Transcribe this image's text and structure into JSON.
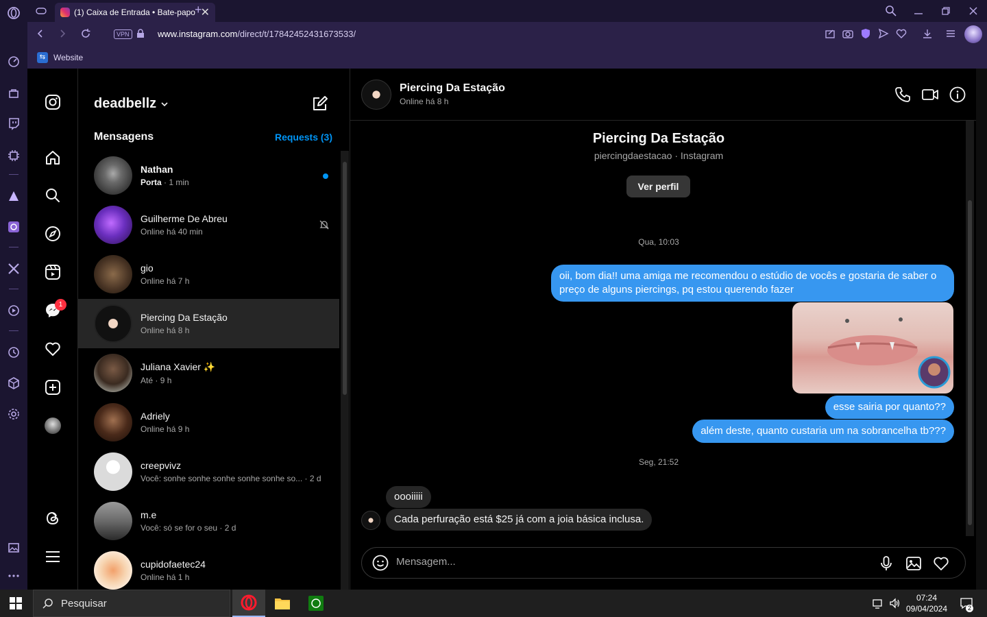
{
  "browser": {
    "tab_title": "(1) Caixa de Entrada • Bate-papo",
    "url_host": "www.instagram.com",
    "url_path": "/direct/t/17842452431673533/",
    "vpn_label": "VPN",
    "bookmark_label": "Website"
  },
  "nav": {
    "notification_count": "1"
  },
  "list": {
    "username": "deadbellz",
    "messages_heading": "Mensagens",
    "requests_label": "Requests (3)",
    "conversations": [
      {
        "name": "Nathan",
        "preview": "Porta",
        "time": "· 1 min",
        "unread": true
      },
      {
        "name": "Guilherme De Abreu",
        "preview": "Online há 40 min",
        "time": "",
        "muted": true
      },
      {
        "name": "gio",
        "preview": "Online há 7 h",
        "time": ""
      },
      {
        "name": "Piercing Da Estação",
        "preview": "Online há 8 h",
        "time": "",
        "selected": true
      },
      {
        "name": "Juliana Xavier ✨",
        "preview": "Até",
        "time": "· 9 h"
      },
      {
        "name": "Adriely",
        "preview": "Online há 9 h",
        "time": ""
      },
      {
        "name": "creepvivz",
        "preview": "Você: sonhe sonhe sonhe sonhe sonhe so...",
        "time": "· 2 d"
      },
      {
        "name": "m.e",
        "preview": "Você: só se for o seu",
        "time": "· 2 d"
      },
      {
        "name": "cupidofaetec24",
        "preview": "Online há 1 h",
        "time": ""
      }
    ]
  },
  "chat": {
    "name": "Piercing Da Estação",
    "status": "Online há 8 h",
    "profile_handle": "piercingdaestacao · Instagram",
    "view_profile_label": "Ver perfil",
    "date1": "Qua, 10:03",
    "out_msg1": "oii, bom dia!! uma amiga me recomendou o estúdio de vocês e gostaria de saber o preço de alguns piercings, pq estou querendo fazer",
    "out_msg2": "esse sairia por quanto??",
    "out_msg3": "além deste, quanto custaria um na sobrancelha tb???",
    "date2": "Seg, 21:52",
    "in_msg1": "oooiiiii",
    "in_msg2": "Cada perfuração está $25 já com a joia básica inclusa.",
    "composer_placeholder": "Mensagem..."
  },
  "taskbar": {
    "search_label": "Pesquisar",
    "time": "07:24",
    "date": "09/04/2024",
    "notifications": "2"
  }
}
